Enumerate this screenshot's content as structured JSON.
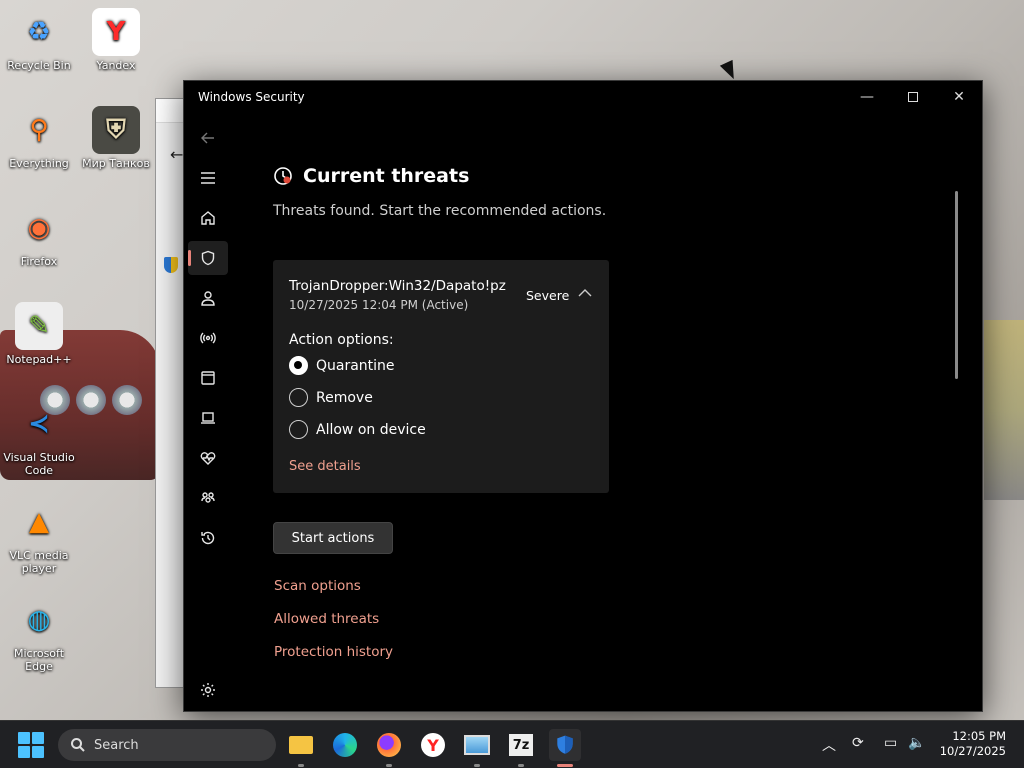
{
  "desktop": {
    "icons": [
      {
        "label": "Recycle Bin",
        "icon": "recycle-bin-icon",
        "glyph": "♻",
        "color": "#4aa3ff",
        "bg": "transparent"
      },
      {
        "label": "Yandex",
        "icon": "yandex-icon",
        "glyph": "Y",
        "color": "#ff2b2b",
        "bg": "#ffffff"
      },
      {
        "label": "Everything",
        "icon": "everything-search-icon",
        "glyph": "⚲",
        "color": "#ff7a1a",
        "bg": "transparent"
      },
      {
        "label": "Мир Танков",
        "icon": "mir-tankov-icon",
        "glyph": "⛨",
        "color": "#e3d7b2",
        "bg": "#4a4a44"
      },
      {
        "label": "Firefox",
        "icon": "firefox-icon",
        "glyph": "◉",
        "color": "#ff7139",
        "bg": "transparent"
      },
      {
        "label": "Notepad++",
        "icon": "notepad-plus-plus-icon",
        "glyph": "✎",
        "color": "#7fc241",
        "bg": "#eeeeee"
      },
      {
        "label": "Visual Studio Code",
        "icon": "vscode-icon",
        "glyph": "≺",
        "color": "#2a8ae0",
        "bg": "transparent"
      },
      {
        "label": "VLC media player",
        "icon": "vlc-icon",
        "glyph": "▲",
        "color": "#ff8800",
        "bg": "transparent"
      },
      {
        "label": "Microsoft Edge",
        "icon": "edge-icon",
        "glyph": "◍",
        "color": "#2bb3e8",
        "bg": "transparent"
      }
    ]
  },
  "window": {
    "title": "Windows Security",
    "page_title": "Current threats",
    "page_subtitle": "Threats found. Start the recommended actions.",
    "threat": {
      "name": "TrojanDropper:Win32/Dapato!pz",
      "date": "10/27/2025 12:04 PM (Active)",
      "severity": "Severe",
      "action_label": "Action options:",
      "options": [
        {
          "label": "Quarantine",
          "checked": true
        },
        {
          "label": "Remove",
          "checked": false
        },
        {
          "label": "Allow on device",
          "checked": false
        }
      ],
      "see_details": "See details"
    },
    "start_actions": "Start actions",
    "links": [
      "Scan options",
      "Allowed threats",
      "Protection history"
    ],
    "accent_color": "#f0a08f"
  },
  "taskbar": {
    "search_placeholder": "Search",
    "clock_time": "12:05 PM",
    "clock_date": "10/27/2025"
  }
}
